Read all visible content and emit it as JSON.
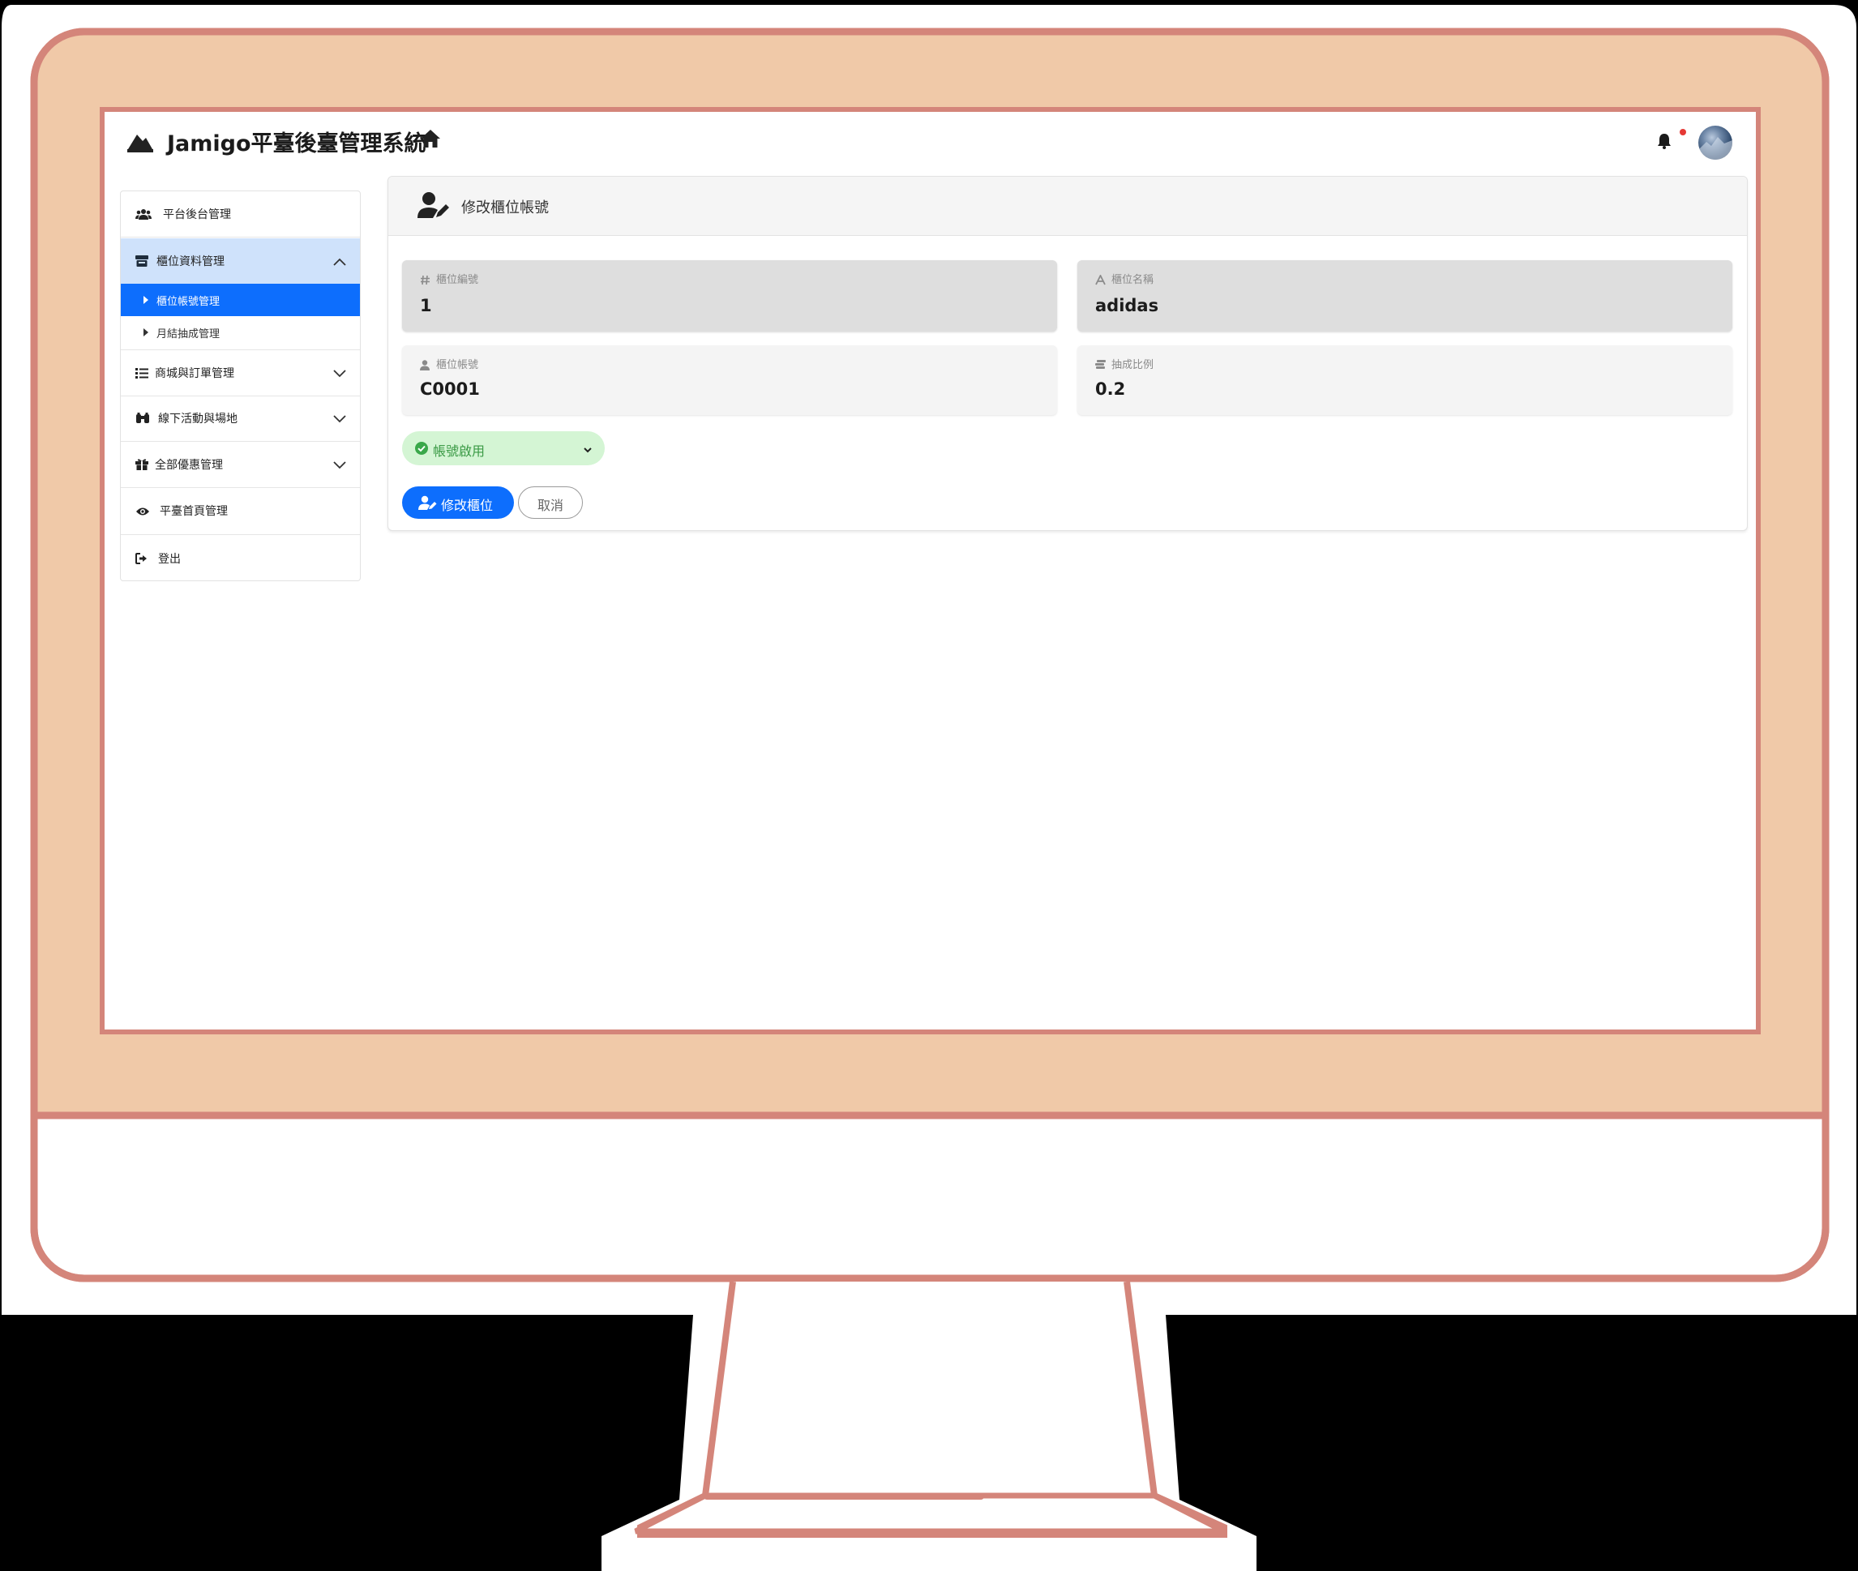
{
  "header": {
    "app_title": "Jamigo平臺後臺管理系統",
    "logo_icon": "jamigo-logo-icon",
    "home_icon": "home-icon",
    "notification_icon": "bell-icon",
    "has_unread_notification": true
  },
  "sidebar": {
    "items": [
      {
        "label": "平台後台管理",
        "icon": "users-icon"
      },
      {
        "label": "櫃位資料管理",
        "icon": "store-icon",
        "expanded": true,
        "children": [
          {
            "label": "櫃位帳號管理",
            "active": true
          },
          {
            "label": "月結抽成管理",
            "active": false
          }
        ]
      },
      {
        "label": "商城與訂單管理",
        "icon": "list-icon",
        "expanded": false
      },
      {
        "label": "線下活動與場地",
        "icon": "binoculars-icon",
        "expanded": false
      },
      {
        "label": "全部優惠管理",
        "icon": "gift-icon",
        "expanded": false
      },
      {
        "label": "平臺首頁管理",
        "icon": "eye-icon"
      },
      {
        "label": "登出",
        "icon": "sign-out-icon"
      }
    ]
  },
  "form": {
    "title": "修改櫃位帳號",
    "fields": {
      "counter_id": {
        "label": "櫃位編號",
        "value": "1",
        "icon": "hashtag-icon",
        "readonly": true
      },
      "counter_name": {
        "label": "櫃位名稱",
        "value": "adidas",
        "icon": "font-icon",
        "readonly": true
      },
      "counter_account": {
        "label": "櫃位帳號",
        "value": "C0001",
        "icon": "user-icon",
        "readonly": false
      },
      "commission_rate": {
        "label": "抽成比例",
        "value": "0.2",
        "icon": "coins-icon",
        "readonly": false
      }
    },
    "status": {
      "selected": "帳號啟用",
      "color": "#3a9a45"
    },
    "submit_label": "修改櫃位",
    "cancel_label": "取消"
  },
  "colors": {
    "accent": "#0d6efd",
    "active_group_bg": "#cfe2fb",
    "status_bg": "#d4f5d4",
    "monitor_frame": "#f0c9a8",
    "monitor_outline": "#d4857a"
  }
}
